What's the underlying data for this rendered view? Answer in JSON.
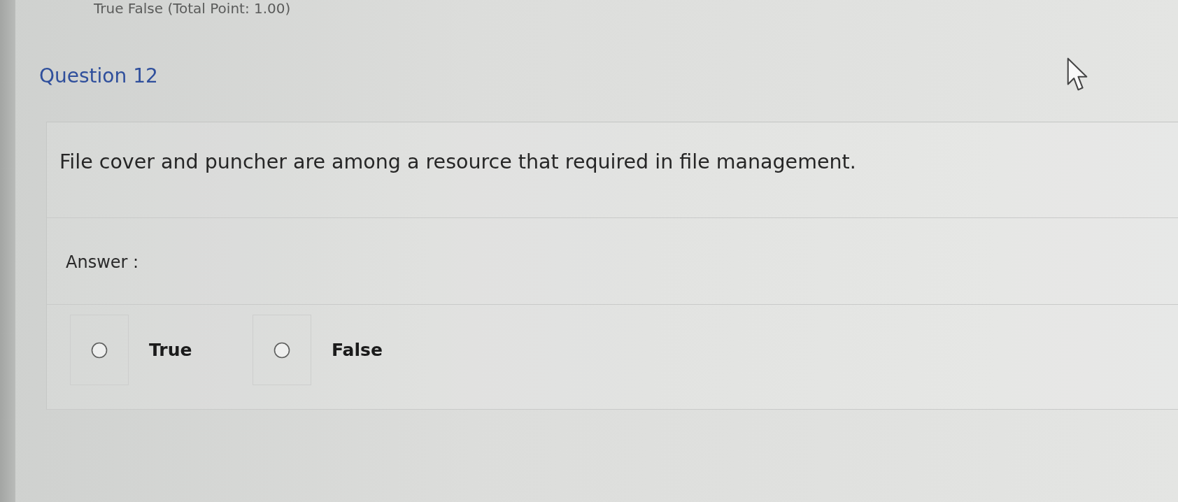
{
  "header": {
    "title": "True False (Total Point: 1.00)"
  },
  "question": {
    "number": "Question 12",
    "text": "File cover and puncher are among a resource that required in file management.",
    "answer_label": "Answer :",
    "options": [
      {
        "label": "True",
        "selected": false
      },
      {
        "label": "False",
        "selected": false
      }
    ]
  }
}
